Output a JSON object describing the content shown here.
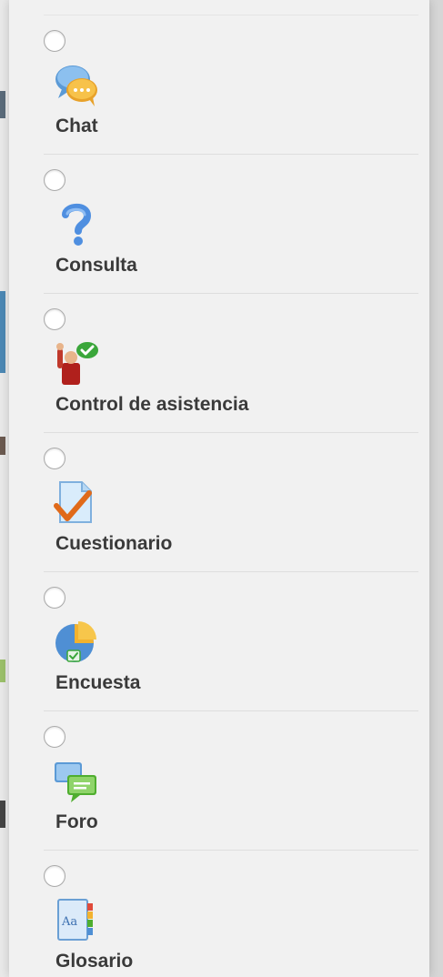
{
  "activity_chooser": {
    "items": [
      {
        "label": "Chat",
        "icon": "chat-icon"
      },
      {
        "label": "Consulta",
        "icon": "question-mark-icon"
      },
      {
        "label": "Control de asistencia",
        "icon": "attendance-icon"
      },
      {
        "label": "Cuestionario",
        "icon": "quiz-checkmark-icon"
      },
      {
        "label": "Encuesta",
        "icon": "survey-chart-icon"
      },
      {
        "label": "Foro",
        "icon": "forum-bubbles-icon"
      },
      {
        "label": "Glosario",
        "icon": "glossary-book-icon"
      }
    ]
  }
}
